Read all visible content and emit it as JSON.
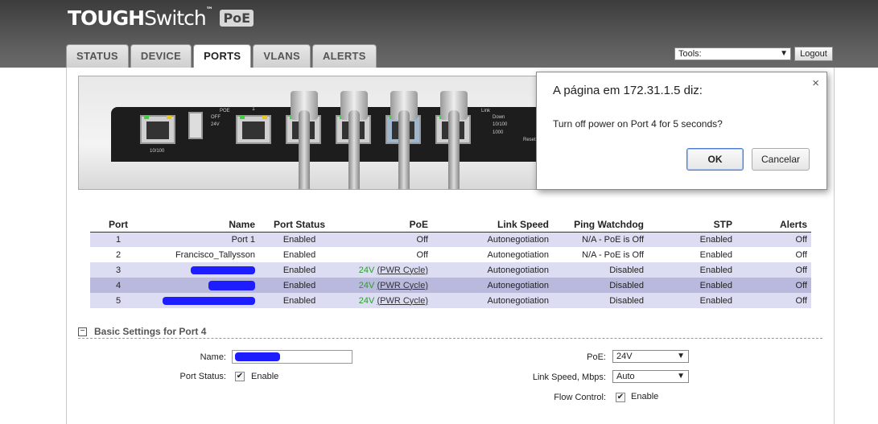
{
  "header": {
    "logo_bold": "TOUGH",
    "logo_thin": "Switch",
    "logo_tm": "™",
    "logo_badge": "PoE"
  },
  "tabs": [
    {
      "label": "STATUS",
      "active": false
    },
    {
      "label": "DEVICE",
      "active": false
    },
    {
      "label": "PORTS",
      "active": true
    },
    {
      "label": "VLANS",
      "active": false
    },
    {
      "label": "ALERTS",
      "active": false
    }
  ],
  "toolbar": {
    "tools_label": "Tools:",
    "logout_label": "Logout"
  },
  "device_image": {
    "port_numbers": [
      "1",
      "2",
      "3",
      "4",
      "5"
    ],
    "poe_label": "POE",
    "off_label": "OFF",
    "v24_label": "24V",
    "mgmt_label": "10/100",
    "link_label": "Link",
    "down_label": "Down",
    "speed1_label": "10/100",
    "speed2_label": "1000",
    "reset_label": "Reset"
  },
  "dialog": {
    "title": "A página em 172.31.1.5 diz:",
    "message": "Turn off power on Port 4 for 5 seconds?",
    "ok_label": "OK",
    "cancel_label": "Cancelar",
    "close_glyph": "×"
  },
  "ports_table": {
    "headers": [
      "Port",
      "Name",
      "Port Status",
      "PoE",
      "Link Speed",
      "Ping Watchdog",
      "STP",
      "Alerts"
    ],
    "rows": [
      {
        "port": "1",
        "name": "Port 1",
        "status": "Enabled",
        "poe": "Off",
        "speed": "Autonegotiation",
        "watchdog": "N/A - PoE is Off",
        "stp": "Enabled",
        "alerts": "Off"
      },
      {
        "port": "2",
        "name": "Francisco_Tallysson",
        "status": "Enabled",
        "poe": "Off",
        "speed": "Autonegotiation",
        "watchdog": "N/A - PoE is Off",
        "stp": "Enabled",
        "alerts": "Off"
      },
      {
        "port": "3",
        "name": "",
        "status": "Enabled",
        "poe": "24V",
        "pwr": "(PWR Cycle)",
        "speed": "Autonegotiation",
        "watchdog": "Disabled",
        "stp": "Enabled",
        "alerts": "Off"
      },
      {
        "port": "4",
        "name": "",
        "status": "Enabled",
        "poe": "24V",
        "pwr": "(PWR Cycle)",
        "speed": "Autonegotiation",
        "watchdog": "Disabled",
        "stp": "Enabled",
        "alerts": "Off"
      },
      {
        "port": "5",
        "name": "",
        "status": "Enabled",
        "poe": "24V",
        "pwr": "(PWR Cycle)",
        "speed": "Autonegotiation",
        "watchdog": "Disabled",
        "stp": "Enabled",
        "alerts": "Off"
      }
    ]
  },
  "basic_settings": {
    "toggle_glyph": "−",
    "title": "Basic Settings for Port 4",
    "name_label": "Name:",
    "name_value": "",
    "port_status_label": "Port Status:",
    "enable_label": "Enable",
    "poe_label": "PoE:",
    "poe_value": "24V",
    "link_speed_label": "Link Speed, Mbps:",
    "link_speed_value": "Auto",
    "flow_control_label": "Flow Control:",
    "flow_enable_label": "Enable"
  },
  "colors": {
    "row_odd": "#dcdcf2",
    "row_selected": "#b9b9dd",
    "poe_green": "#2f9b2f",
    "redaction_blue": "#1d1dff"
  }
}
